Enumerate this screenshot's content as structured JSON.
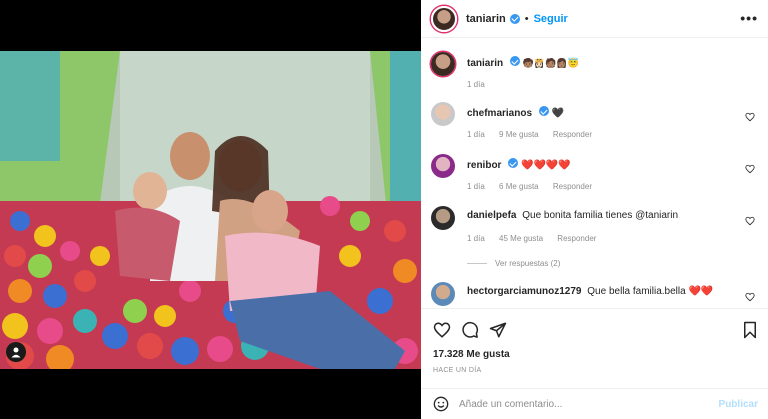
{
  "post": {
    "author": "taniarin",
    "follow_label": "Seguir",
    "separator": "•",
    "more_label": "•••"
  },
  "caption": {
    "author": "taniarin",
    "text": "🧒🏽👸🏻🧑🏽👩🏽😇",
    "time": "1 día"
  },
  "comments": [
    {
      "author": "chefmarianos",
      "verified": true,
      "text": "🖤",
      "time": "1 día",
      "likes": "9 Me gusta",
      "reply": "Responder"
    },
    {
      "author": "renibor",
      "verified": true,
      "text": "❤️❤️❤️❤️",
      "time": "1 día",
      "likes": "6 Me gusta",
      "reply": "Responder"
    },
    {
      "author": "danielpefa",
      "verified": false,
      "text": "Que bonita familia tienes @taniarin",
      "time": "1 día",
      "likes": "45 Me gusta",
      "reply": "Responder",
      "view_replies": "Ver respuestas (2)"
    },
    {
      "author": "hectorgarciamunoz1279",
      "verified": false,
      "text": "Que bella familia.bella ❤️❤️"
    }
  ],
  "stats": {
    "likes": "17.328 Me gusta",
    "posted": "HACE UN DÍA"
  },
  "composer": {
    "placeholder": "Añade un comentario...",
    "publish_label": "Publicar"
  },
  "icons": [
    "user-tag-icon",
    "verified-icon",
    "more-options-icon",
    "heart-icon",
    "comment-icon",
    "share-icon",
    "save-icon",
    "emoji-icon"
  ],
  "colors": {
    "accent": "#0095f6",
    "verified": "#3897f0",
    "heart": "#e0245e"
  }
}
